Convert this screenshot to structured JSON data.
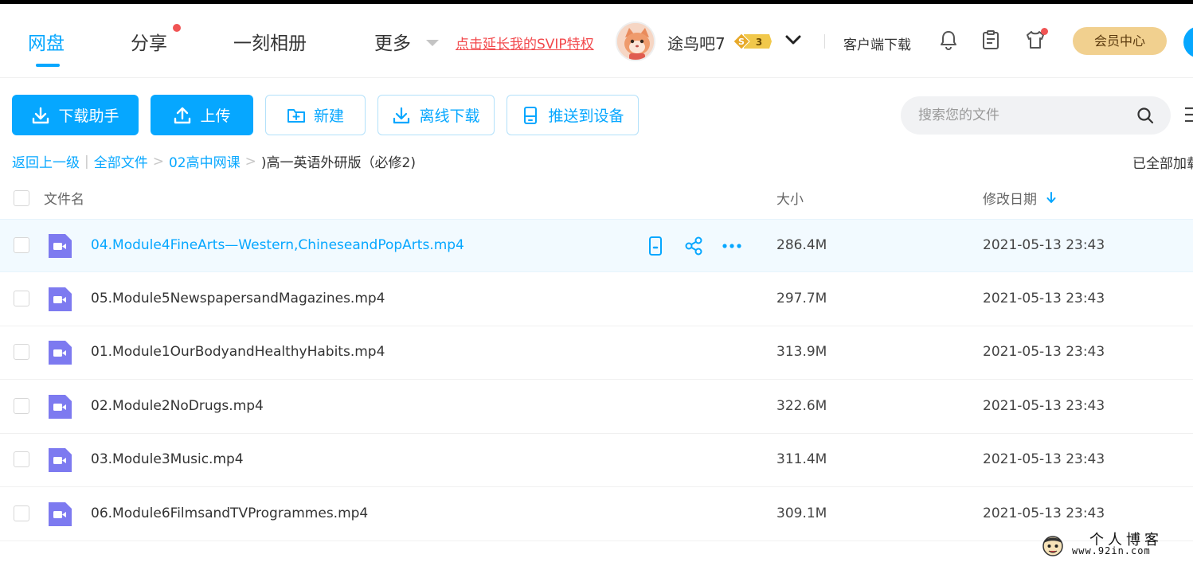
{
  "header": {
    "nav": [
      {
        "label": "网盘",
        "active": true
      },
      {
        "label": "分享",
        "badge": true
      },
      {
        "label": "一刻相册"
      },
      {
        "label": "更多"
      }
    ],
    "svip_link": "点击延长我的SVIP特权",
    "username": "途鸟吧7",
    "coin_symbol": "S",
    "coin_level": "3",
    "client_download": "客户端下载",
    "vip_center": "会员中心"
  },
  "toolbar": {
    "download_helper": "下载助手",
    "upload": "上传",
    "new_folder": "新建",
    "offline_download": "离线下载",
    "push_to_device": "推送到设备"
  },
  "search": {
    "placeholder": "搜索您的文件"
  },
  "breadcrumb": {
    "back": "返回上一级",
    "root": "全部文件",
    "level1": "02高中网课",
    "current": ")高一英语外研版（必修2)"
  },
  "loaded_status": "已全部加载",
  "table": {
    "col_name": "文件名",
    "col_size": "大小",
    "col_date": "修改日期",
    "rows": [
      {
        "name": "04.Module4FineArts—Western,ChineseandPopArts.mp4",
        "size": "286.4M",
        "date": "2021-05-13 23:43"
      },
      {
        "name": "05.Module5NewspapersandMagazines.mp4",
        "size": "297.7M",
        "date": "2021-05-13 23:43"
      },
      {
        "name": "01.Module1OurBodyandHealthyHabits.mp4",
        "size": "313.9M",
        "date": "2021-05-13 23:43"
      },
      {
        "name": "02.Module2NoDrugs.mp4",
        "size": "322.6M",
        "date": "2021-05-13 23:43"
      },
      {
        "name": "03.Module3Music.mp4",
        "size": "311.4M",
        "date": "2021-05-13 23:43"
      },
      {
        "name": "06.Module6FilmsandTVProgrammes.mp4",
        "size": "309.1M",
        "date": "2021-05-13 23:43"
      }
    ]
  },
  "watermark": {
    "title": "个人博客",
    "url": "www.92in.com"
  },
  "colors": {
    "accent": "#06a7ff",
    "video_icon": "#7d7af0",
    "svip_red": "#f2494c",
    "vip_gold": "#f1d08f"
  }
}
